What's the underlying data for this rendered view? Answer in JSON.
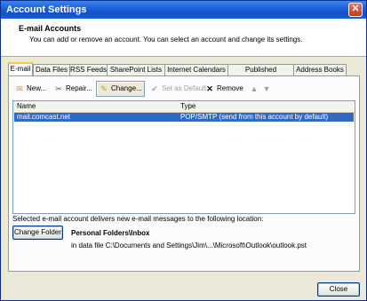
{
  "window": {
    "title": "Account Settings",
    "close_glyph": "✕"
  },
  "header": {
    "title": "E-mail Accounts",
    "subtitle": "You can add or remove an account. You can select an account and change its settings."
  },
  "tabs": [
    {
      "label": "E-mail"
    },
    {
      "label": "Data Files"
    },
    {
      "label": "RSS Feeds"
    },
    {
      "label": "SharePoint Lists"
    },
    {
      "label": "Internet Calendars"
    },
    {
      "label": "Published Calendars"
    },
    {
      "label": "Address Books"
    }
  ],
  "toolbar": {
    "new": "New...",
    "repair": "Repair...",
    "change": "Change...",
    "set_default": "Set as Default",
    "remove": "Remove"
  },
  "accounts": {
    "headers": {
      "name": "Name",
      "type": "Type"
    },
    "rows": [
      {
        "name": "mail.comcast.net",
        "type": "POP/SMTP (send from this account by default)"
      }
    ]
  },
  "delivery": {
    "text": "Selected e-mail account delivers new e-mail messages to the following location:",
    "change_folder": "Change Folder",
    "folder": "Personal Folders\\Inbox",
    "data_file": "in data file C:\\Documents and Settings\\Jim\\...\\Microsoft\\Outlook\\outlook.pst"
  },
  "footer": {
    "close": "Close"
  }
}
